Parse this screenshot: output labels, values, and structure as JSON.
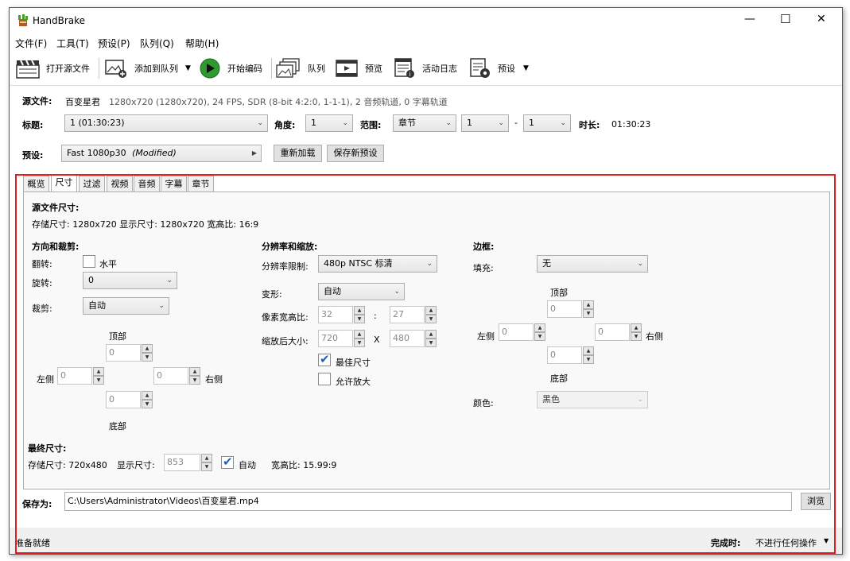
{
  "app": {
    "title": "HandBrake"
  },
  "window_controls": {
    "minimize": "—",
    "maximize": "☐",
    "close": "✕"
  },
  "menu": [
    "文件(F)",
    "工具(T)",
    "预设(P)",
    "队列(Q)",
    "帮助(H)"
  ],
  "toolbar": {
    "open_source": "打开源文件",
    "add_to_queue": "添加到队列",
    "start_encode": "开始编码",
    "queue": "队列",
    "preview": "预览",
    "activity_log": "活动日志",
    "presets": "预设"
  },
  "source": {
    "label": "源文件:",
    "name": "百变星君",
    "info": "1280x720 (1280x720), 24 FPS, SDR (8-bit 4:2:0, 1-1-1), 2 音频轨道, 0 字幕轨道"
  },
  "title_row": {
    "title_label": "标题:",
    "title_value": "1  (01:30:23)",
    "angle_label": "角度:",
    "angle_value": "1",
    "range_label": "范围:",
    "range_type": "章节",
    "range_start": "1",
    "range_dash": "-",
    "range_end": "1",
    "duration_label": "时长:",
    "duration_value": "01:30:23"
  },
  "preset_row": {
    "label": "预设:",
    "value": "Fast 1080p30",
    "modified": "(Modified)",
    "reload": "重新加载",
    "save_new": "保存新预设"
  },
  "tabs": [
    "概览",
    "尺寸",
    "过滤",
    "视频",
    "音频",
    "字幕",
    "章节"
  ],
  "active_tab": "尺寸",
  "dimensions": {
    "source_dims_title": "源文件尺寸:",
    "source_dims_text": "存储尺寸: 1280x720  显示尺寸: 1280x720  宽高比: 16:9",
    "orientation": {
      "title": "方向和裁剪:",
      "flip_label": "翻转:",
      "flip_horizontal": "水平",
      "rotate_label": "旋转:",
      "rotate_value": "0",
      "crop_label": "裁剪:",
      "crop_value": "自动",
      "top_label": "顶部",
      "top_value": "0",
      "left_label": "左侧",
      "left_value": "0",
      "right_label": "右侧",
      "right_value": "0",
      "bottom_label": "底部",
      "bottom_value": "0"
    },
    "resolution": {
      "title": "分辨率和缩放:",
      "limit_label": "分辨率限制:",
      "limit_value": "480p NTSC 标清",
      "anamorphic_label": "变形:",
      "anamorphic_value": "自动",
      "par_label": "像素宽高比:",
      "par_w": "32",
      "par_sep": ":",
      "par_h": "27",
      "scaled_label": "缩放后大小:",
      "scaled_w": "720",
      "scaled_sep": "X",
      "scaled_h": "480",
      "optimal_size": "最佳尺寸",
      "allow_upscale": "允许放大"
    },
    "borders": {
      "title": "边框:",
      "fill_label": "填充:",
      "fill_value": "无",
      "top_label": "顶部",
      "top_value": "0",
      "left_label": "左侧",
      "left_value": "0",
      "right_label": "右侧",
      "right_value": "0",
      "bottom_label": "底部",
      "bottom_value": "0",
      "color_label": "颜色:",
      "color_value": "黑色"
    },
    "final": {
      "title": "最终尺寸:",
      "storage_text": "存储尺寸: 720x480",
      "display_label": "显示尺寸:",
      "display_value": "853",
      "auto_label": "自动",
      "aspect_text": "宽高比: 15.99:9"
    }
  },
  "save_as": {
    "label": "保存为:",
    "path": "C:\\Users\\Administrator\\Videos\\百变星君.mp4",
    "browse": "浏览"
  },
  "status": {
    "ready": "准备就绪",
    "on_done_label": "完成时:",
    "on_done_value": "不进行任何操作"
  },
  "colors": {
    "highlight_border": "#e02020",
    "check_blue": "#1e5fb4",
    "play_green": "#2e9b2e"
  }
}
